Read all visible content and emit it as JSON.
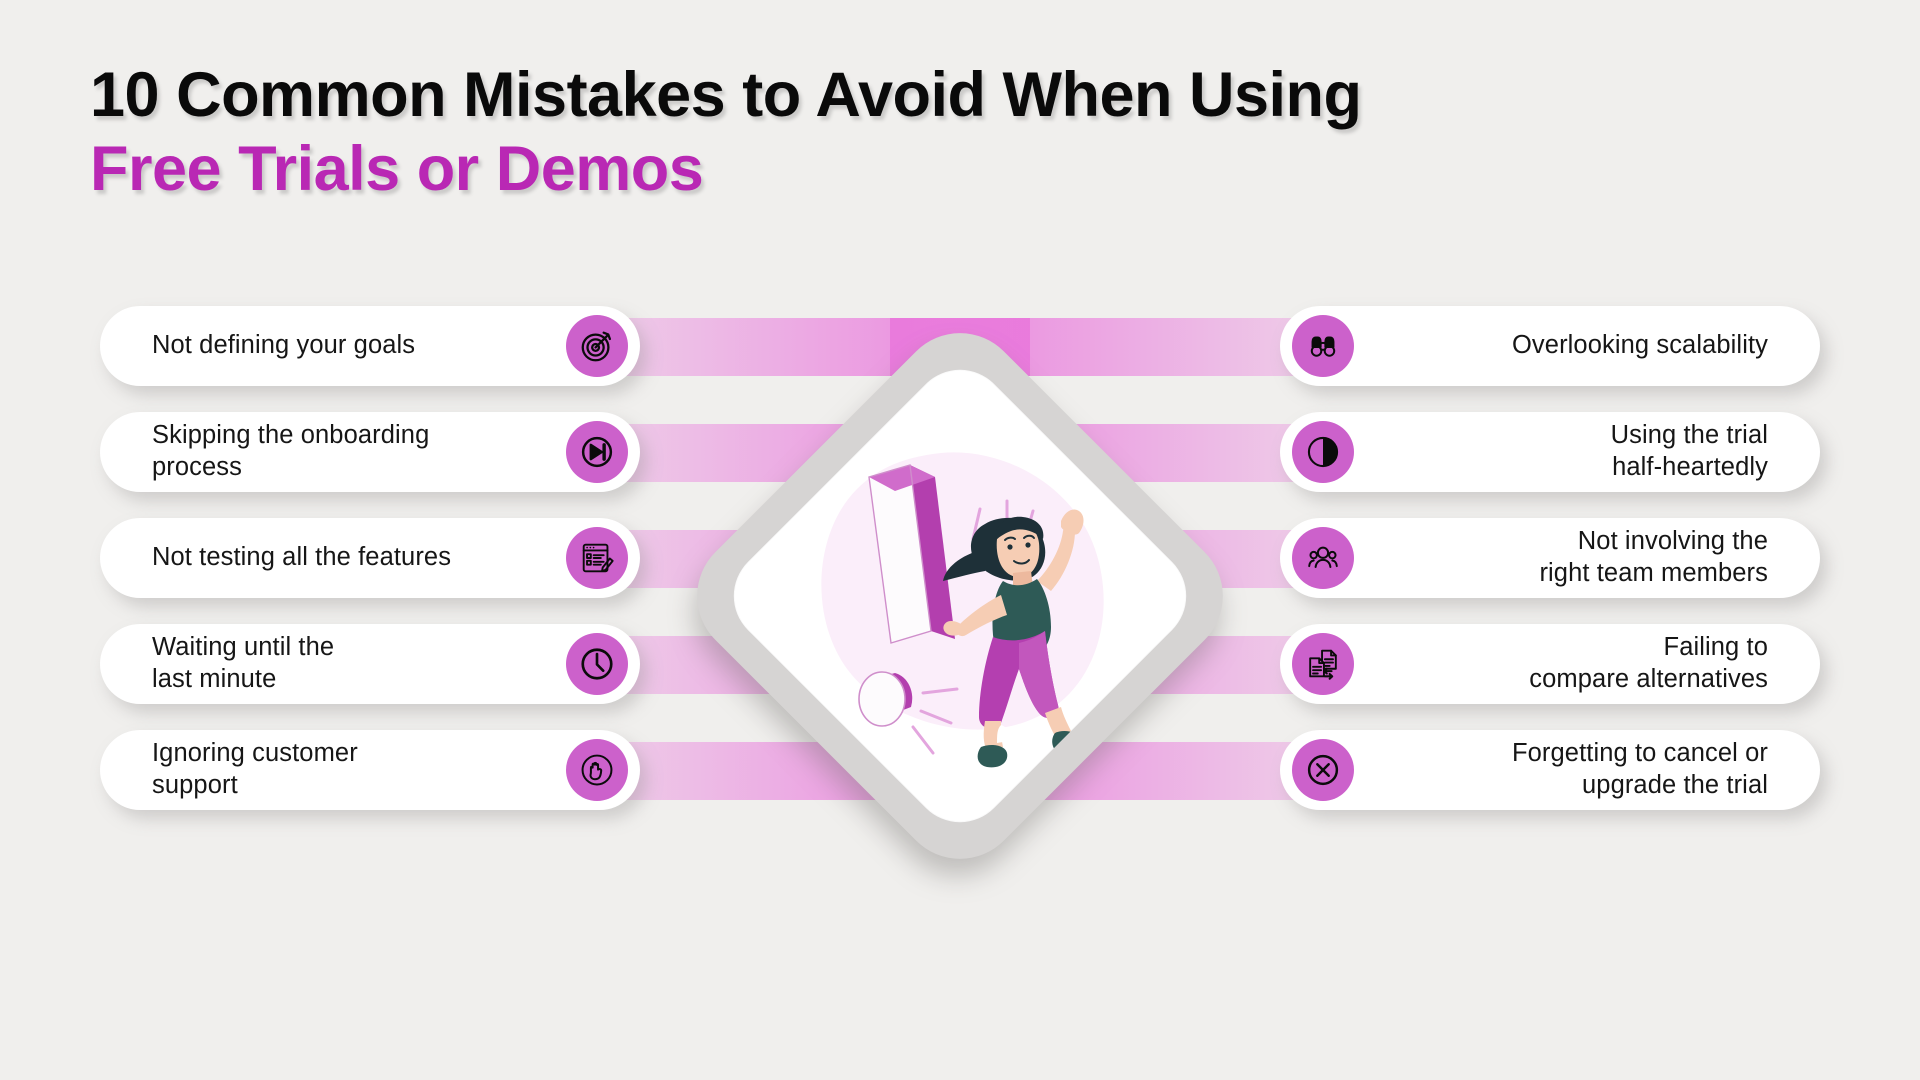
{
  "title": {
    "line1": "10 Common Mistakes to Avoid When Using",
    "line2": "Free Trials or Demos",
    "color_line1": "#0a0a0a",
    "color_line2": "#b928b4"
  },
  "theme": {
    "background": "#f0efed",
    "accent_purple": "#b928b4",
    "icon_circle": "#cc61cb",
    "stripe_pink": "#e978dc",
    "diamond_border": "#d6d4d3",
    "card_white": "#ffffff",
    "text_dark": "#161616"
  },
  "center": {
    "illustration_name": "woman-with-exclamation-mark",
    "shape": "diamond-card"
  },
  "left_items": [
    {
      "label": "Not defining your goals",
      "icon": "target-icon"
    },
    {
      "label": "Skipping the onboarding\nprocess",
      "icon": "skip-forward-icon"
    },
    {
      "label": "Not testing all the features",
      "icon": "checklist-pencil-icon"
    },
    {
      "label": "Waiting until the\nlast minute",
      "icon": "clock-icon"
    },
    {
      "label": "Ignoring customer\nsupport",
      "icon": "raised-hand-icon"
    }
  ],
  "right_items": [
    {
      "label": "Overlooking scalability",
      "icon": "binoculars-icon"
    },
    {
      "label": "Using the trial\nhalf-heartedly",
      "icon": "half-circle-icon"
    },
    {
      "label": "Not involving the\nright team members",
      "icon": "people-group-icon"
    },
    {
      "label": "Failing to\ncompare alternatives",
      "icon": "compare-documents-icon"
    },
    {
      "label": "Forgetting to cancel or\nupgrade the trial",
      "icon": "x-circle-icon"
    }
  ]
}
